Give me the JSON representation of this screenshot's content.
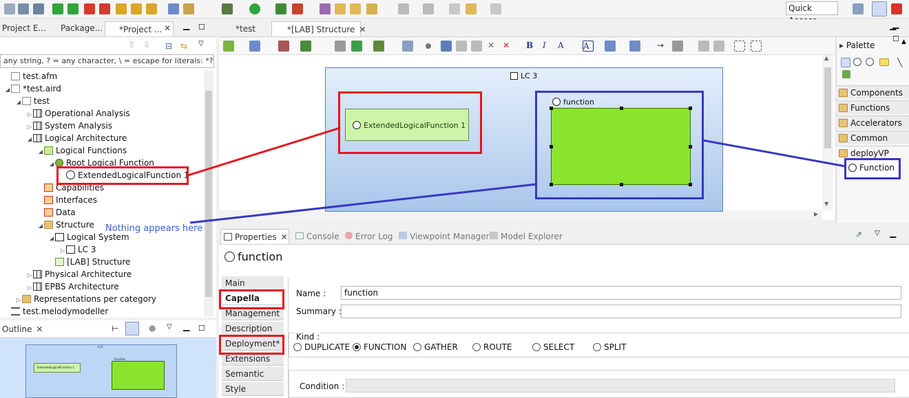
{
  "toolbar": {
    "quick_access": "Quick Access"
  },
  "left_panel": {
    "tabs": [
      "Project E...",
      "Package...",
      "*Project ..."
    ],
    "filter_text": "any string, ? = any character, \\ = escape for literals: *?\\",
    "tree": [
      {
        "label": "test.afm"
      },
      {
        "label": "*test.aird"
      },
      {
        "label": "test"
      },
      {
        "label": "Operational Analysis"
      },
      {
        "label": "System Analysis"
      },
      {
        "label": "Logical Architecture"
      },
      {
        "label": "Logical Functions"
      },
      {
        "label": "Root Logical Function"
      },
      {
        "label": "ExtendedLogicalFunction 1"
      },
      {
        "label": "Capabilities"
      },
      {
        "label": "Interfaces"
      },
      {
        "label": "Data"
      },
      {
        "label": "Structure"
      },
      {
        "label": "Logical System"
      },
      {
        "label": "LC 3"
      },
      {
        "label": "[LAB] Structure"
      },
      {
        "label": "Physical Architecture"
      },
      {
        "label": "EPBS Architecture"
      },
      {
        "label": "Representations per category"
      },
      {
        "label": "test.melodymodeller"
      }
    ],
    "annotation": "Nothing appears here"
  },
  "outline": {
    "title": "Outline",
    "mini_left": "ExtendedLogicalFunction 1",
    "mini_right": "function",
    "mini_top": "LC3"
  },
  "editor": {
    "tabs": [
      "*test",
      "*[LAB] Structure"
    ],
    "container_label": "LC 3",
    "elf_label": "ExtendedLogicalFunction 1",
    "function_label": "function"
  },
  "palette": {
    "title": "Palette",
    "items": [
      "Components",
      "Functions",
      "Accelerators",
      "Common",
      "deployVP"
    ],
    "function_tool": "Function"
  },
  "properties": {
    "tabs": [
      "Properties",
      "Console",
      "Error Log",
      "Viewpoint Manager",
      "Model Explorer"
    ],
    "title": "function",
    "side_tabs": [
      "Main",
      "Capella",
      "Management",
      "Description",
      "Deployment*",
      "Extensions",
      "Semantic",
      "Style"
    ],
    "name_label": "Name :",
    "name_value": "function",
    "summary_label": "Summary :",
    "kind_label": "Kind :",
    "kinds": [
      "DUPLICATE",
      "FUNCTION",
      "GATHER",
      "ROUTE",
      "SELECT",
      "SPLIT"
    ],
    "kind_selected": "FUNCTION",
    "condition_label": "Condition :"
  },
  "colors": {
    "highlight_red": "#e5141e",
    "highlight_blue": "#3838c2",
    "function_fill": "#8be42e",
    "elf_fill": "#ccf5a8"
  }
}
